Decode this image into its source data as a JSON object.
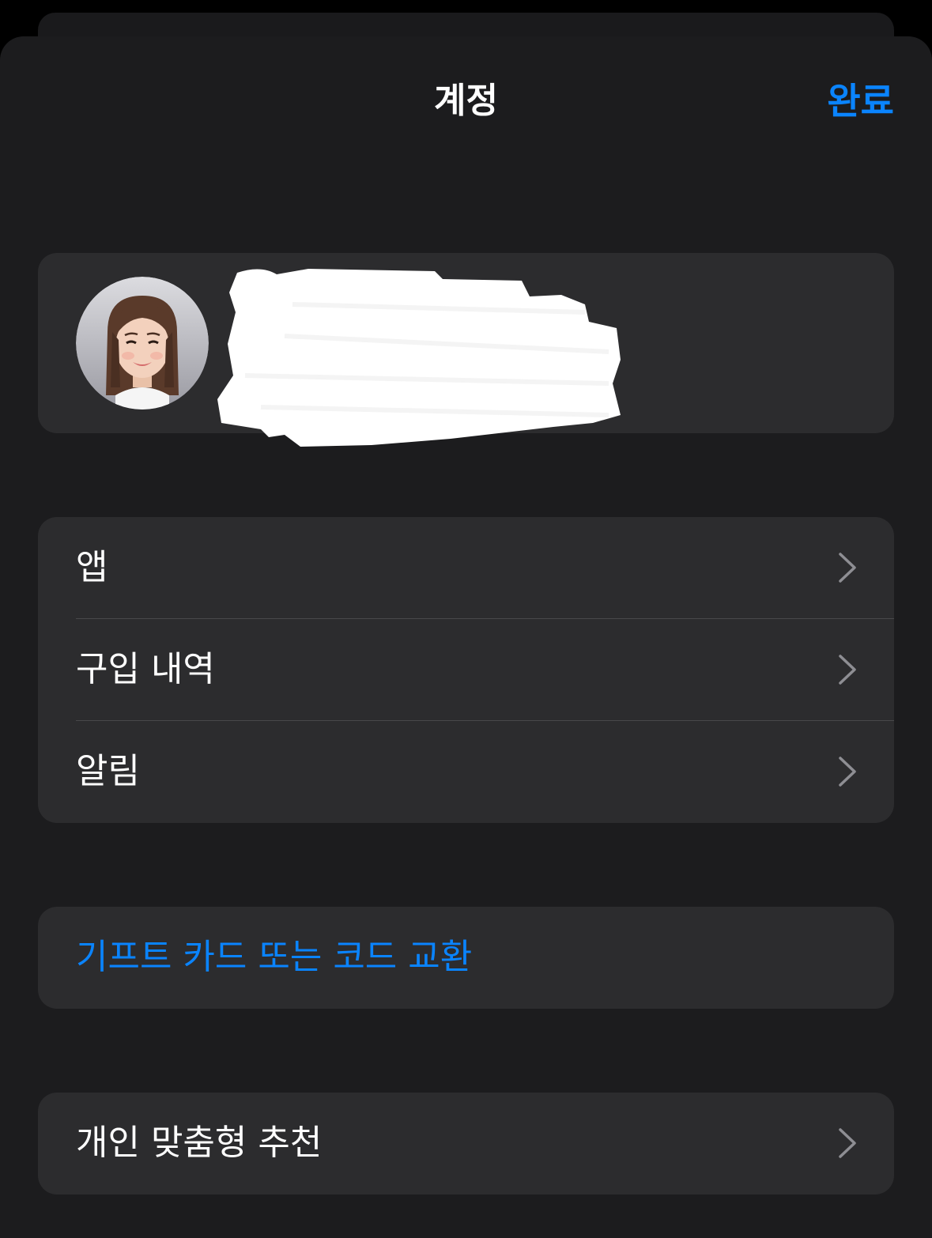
{
  "header": {
    "title": "계정",
    "done_label": "완료"
  },
  "profile": {
    "avatar_icon": "memoji-avatar",
    "name_redacted": true
  },
  "menu": {
    "items": [
      {
        "label": "앱",
        "icon": "chevron-right-icon"
      },
      {
        "label": "구입 내역",
        "icon": "chevron-right-icon"
      },
      {
        "label": "알림",
        "icon": "chevron-right-icon"
      }
    ]
  },
  "gift": {
    "label": "기프트 카드 또는 코드 교환"
  },
  "recommendations": {
    "label": "개인 맞춤형 추천",
    "icon": "chevron-right-icon"
  },
  "colors": {
    "background": "#1c1c1e",
    "card": "#2c2c2e",
    "accent": "#0a84ff",
    "text": "#ffffff",
    "chevron": "#8e8e93"
  }
}
